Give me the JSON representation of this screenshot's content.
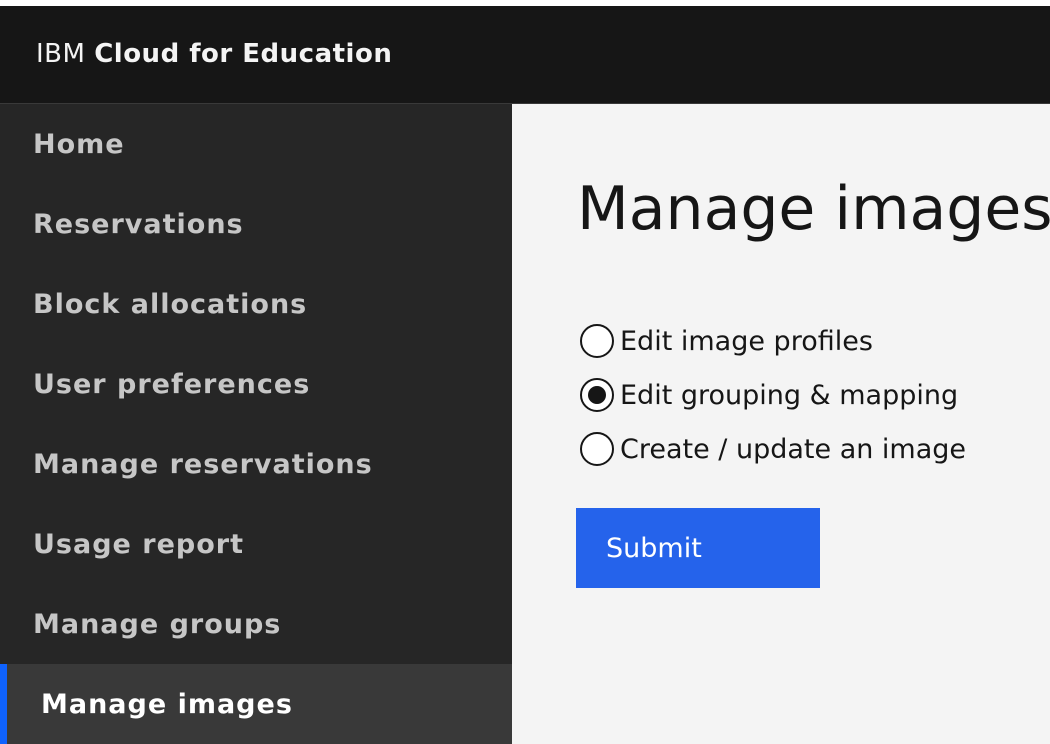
{
  "header": {
    "brand_prefix": "IBM",
    "brand_rest": "Cloud for Education"
  },
  "sidebar": {
    "items": [
      {
        "label": "Home"
      },
      {
        "label": "Reservations"
      },
      {
        "label": "Block allocations"
      },
      {
        "label": "User preferences"
      },
      {
        "label": "Manage reservations"
      },
      {
        "label": "Usage report"
      },
      {
        "label": "Manage groups"
      },
      {
        "label": "Manage images",
        "active": true
      }
    ]
  },
  "main": {
    "title": "Manage images",
    "options": [
      {
        "label": "Edit image profiles",
        "checked": false
      },
      {
        "label": "Edit grouping & mapping",
        "checked": true
      },
      {
        "label": "Create / update an image",
        "checked": false
      }
    ],
    "submit_label": "Submit"
  },
  "colors": {
    "header_bg": "#161616",
    "sidebar_bg": "#262626",
    "active_bg": "#393939",
    "accent": "#0f62fe",
    "button": "#2563eb"
  }
}
